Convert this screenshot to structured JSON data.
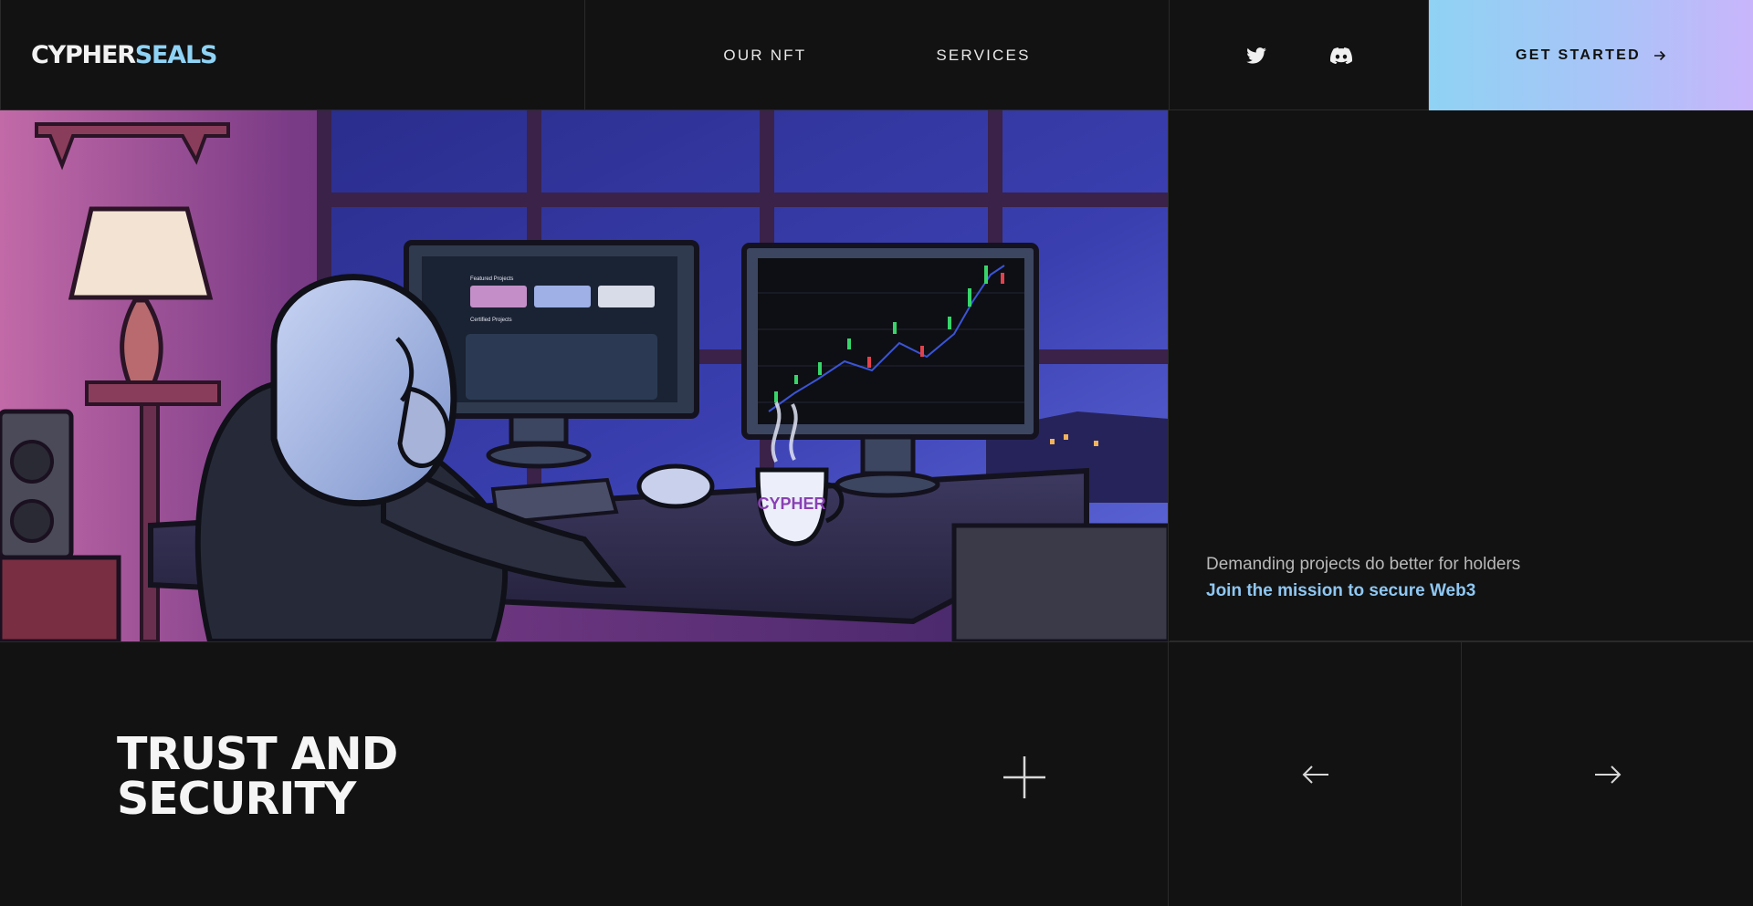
{
  "header": {
    "logo_part1": "CYPHER",
    "logo_part2": "SEALS",
    "nav": [
      "OUR NFT",
      "SERVICES"
    ],
    "social": [
      "twitter-icon",
      "discord-icon"
    ],
    "cta_label": "GET STARTED",
    "cta_icon": "arrow-right-icon"
  },
  "hero": {
    "scene": "seal-trader-illustration",
    "mug_text": "CYPHER",
    "monitor_heading_1": "Featured Projects",
    "monitor_heading_2": "Certified Projects"
  },
  "side": {
    "tagline": "Demanding projects do better for holders",
    "link": "Join the mission to secure Web3"
  },
  "section": {
    "title": "TRUST AND\nSECURITY",
    "expand_icon": "plus-icon",
    "prev_icon": "arrow-left-icon",
    "next_icon": "arrow-right-icon"
  },
  "colors": {
    "background": "#121212",
    "accent_blue": "#8fd3f5",
    "link": "#8fc7f2",
    "cta_gradient_start": "#8fd2f3",
    "cta_gradient_end": "#c9b5fb"
  }
}
